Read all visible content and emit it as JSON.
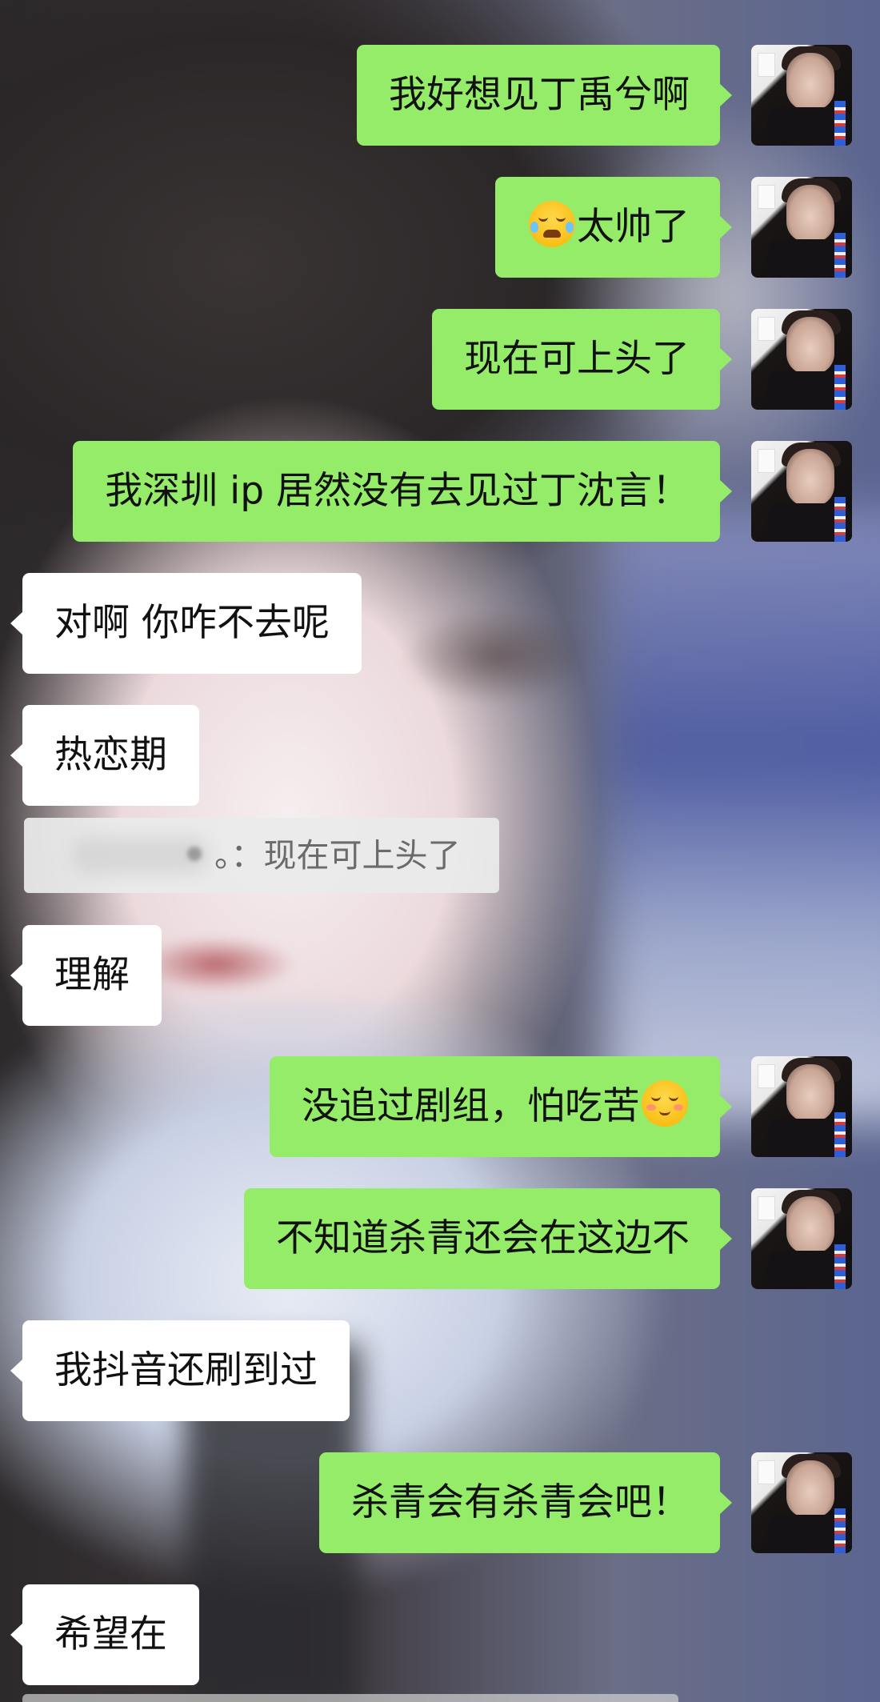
{
  "messages": [
    {
      "side": "me",
      "text": "我好想见丁禹兮啊"
    },
    {
      "side": "me",
      "emoji": "grinning-squinting-tears-emoji",
      "text": "太帅了"
    },
    {
      "side": "me",
      "text": "现在可上头了"
    },
    {
      "side": "me",
      "text": "我深圳 ip 居然没有去见过丁沈言！"
    },
    {
      "side": "them",
      "text": "对啊 你咋不去呢"
    },
    {
      "side": "them",
      "text": "热恋期"
    },
    {
      "side": "quote",
      "prefix": "。：",
      "text": "现在可上头了"
    },
    {
      "side": "them",
      "text": "理解"
    },
    {
      "side": "me",
      "text": "没追过剧组，怕吃苦",
      "emoji": "smiling-blush-emoji"
    },
    {
      "side": "me",
      "text": "不知道杀青还会在这边不"
    },
    {
      "side": "them",
      "text": "我抖音还刷到过"
    },
    {
      "side": "me",
      "text": "杀青会有杀青会吧！"
    },
    {
      "side": "them",
      "text": "希望在"
    }
  ],
  "colors": {
    "my_bubble": "#95ec69",
    "their_bubble": "#ffffff",
    "quote_bg": "#ebebeb"
  }
}
